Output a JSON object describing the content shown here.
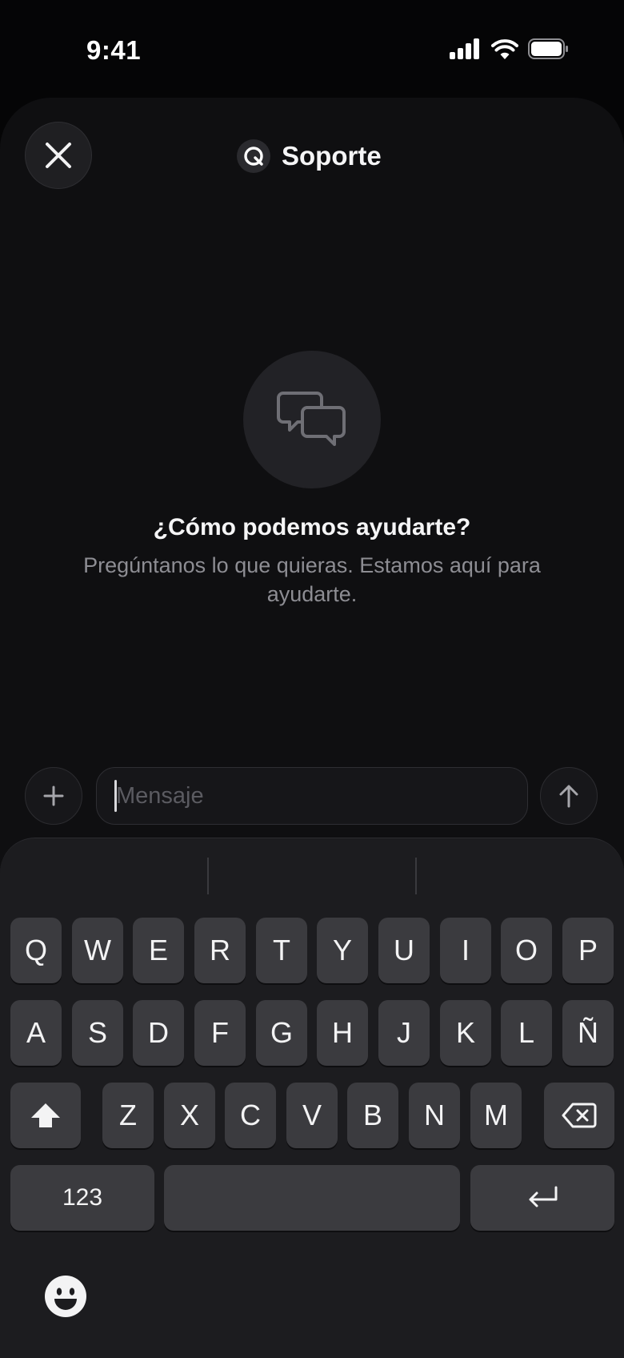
{
  "status_bar": {
    "time": "9:41",
    "icons": [
      "cellular-signal-icon",
      "wifi-icon",
      "battery-icon"
    ]
  },
  "header": {
    "close_icon": "close-icon",
    "logo_icon": "q-logo-icon",
    "title": "Soporte"
  },
  "empty_state": {
    "icon": "chat-bubbles-icon",
    "heading": "¿Cómo podemos ayudarte?",
    "body": "Pregúntanos lo que quieras. Estamos aquí para ayudarte."
  },
  "composer": {
    "add_icon": "plus-icon",
    "placeholder": "Mensaje",
    "value": "",
    "send_icon": "arrow-up-icon"
  },
  "keyboard": {
    "row1": [
      "Q",
      "W",
      "E",
      "R",
      "T",
      "Y",
      "U",
      "I",
      "O",
      "P"
    ],
    "row2": [
      "A",
      "S",
      "D",
      "F",
      "G",
      "H",
      "J",
      "K",
      "L",
      "Ñ"
    ],
    "row3": [
      "Z",
      "X",
      "C",
      "V",
      "B",
      "N",
      "M"
    ],
    "numbers_label": "123",
    "icons": [
      "shift-icon",
      "backspace-icon",
      "return-icon",
      "emoji-icon"
    ]
  },
  "colors": {
    "background": "#050506",
    "sheet": "#0f0f11",
    "keyboard": "#1c1c1f",
    "key": "#3b3b3f",
    "muted_text": "#8d8d93"
  }
}
